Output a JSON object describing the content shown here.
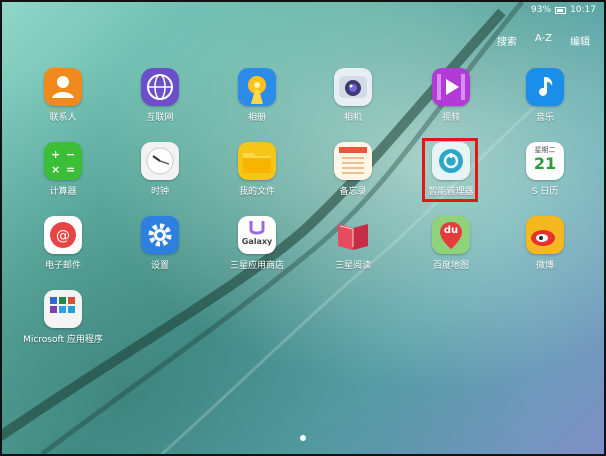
{
  "status_bar": {
    "battery": "93%",
    "time": "10:17"
  },
  "top_menu": {
    "search": "搜索",
    "az": "A-Z",
    "edit": "编辑"
  },
  "apps": [
    {
      "label": "联系人"
    },
    {
      "label": "互联网"
    },
    {
      "label": "相册"
    },
    {
      "label": "相机"
    },
    {
      "label": "视频"
    },
    {
      "label": "音乐"
    },
    {
      "label": "计算器"
    },
    {
      "label": "时钟"
    },
    {
      "label": "我的文件"
    },
    {
      "label": "备忘录"
    },
    {
      "label": "智能管理器"
    },
    {
      "label": "S 日历",
      "icon_top": "星期二",
      "icon_day": "21"
    },
    {
      "label": "电子邮件"
    },
    {
      "label": "设置"
    },
    {
      "label": "三星应用商店",
      "icon_text": "Galaxy"
    },
    {
      "label": "三星阅读"
    },
    {
      "label": "百度地图",
      "icon_text": "du"
    },
    {
      "label": "微博"
    },
    {
      "label": "Microsoft 应用程序"
    }
  ],
  "highlighted_app": "智能管理器",
  "colors": {
    "highlight": "#e01818"
  }
}
